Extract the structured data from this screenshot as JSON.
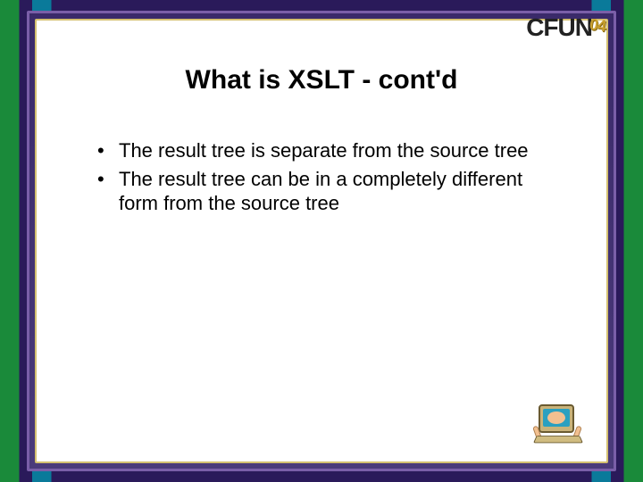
{
  "branding": {
    "logo_text": "CFUN",
    "logo_suffix": "04"
  },
  "slide": {
    "title": "What is XSLT -  cont'd",
    "bullets": [
      "The result tree is separate from the source tree",
      "The result tree can be in a completely different form from the source tree"
    ]
  }
}
